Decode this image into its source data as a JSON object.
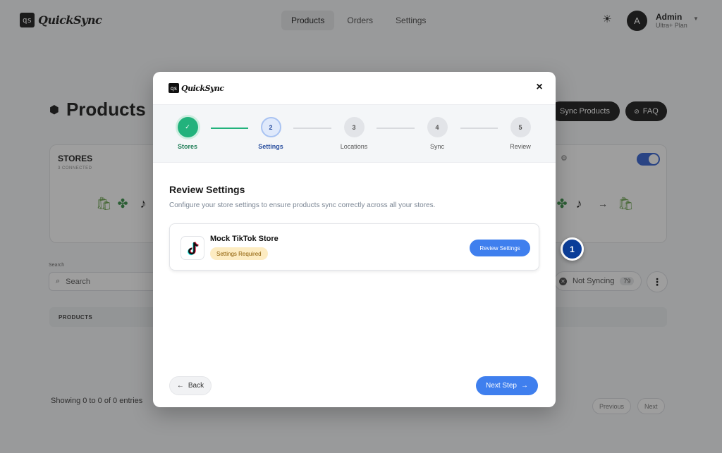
{
  "app": {
    "logo_mark": "qs",
    "logo_text": "QuickSync"
  },
  "nav": {
    "items": [
      "Products",
      "Orders",
      "Settings"
    ],
    "active": "Products"
  },
  "user": {
    "initial": "A",
    "name": "Admin",
    "plan": "Ultra+ Plan"
  },
  "page": {
    "title": "Products",
    "sync_button": "Sync Products",
    "faq_button": "FAQ",
    "stores_card": {
      "title": "STORES",
      "subtitle": "3 CONNECTED",
      "toggle_on": true
    },
    "search": {
      "label": "Search",
      "placeholder": "Search"
    },
    "filter": {
      "label": "Not Syncing",
      "count": "79"
    },
    "table_header": "PRODUCTS",
    "entries_text": "Showing 0 to 0 of 0 entries",
    "pager": {
      "previous": "Previous",
      "next": "Next"
    }
  },
  "tour": {
    "step_number": "1"
  },
  "modal": {
    "close_label": "×",
    "steps": [
      {
        "number": "✓",
        "label": "Stores",
        "state": "done"
      },
      {
        "number": "2",
        "label": "Settings",
        "state": "current"
      },
      {
        "number": "3",
        "label": "Locations",
        "state": "todo"
      },
      {
        "number": "4",
        "label": "Sync",
        "state": "todo"
      },
      {
        "number": "5",
        "label": "Review",
        "state": "todo"
      }
    ],
    "section_title": "Review Settings",
    "section_description": "Configure your store settings to ensure products sync correctly across all your stores.",
    "store": {
      "name": "Mock TikTok Store",
      "badge": "Settings Required",
      "action": "Review Settings"
    },
    "back_label": "Back",
    "next_label": "Next Step"
  },
  "colors": {
    "accent": "#3f7fee",
    "success": "#22b27c",
    "warning_bg": "#fdecc2",
    "dark": "#111111"
  }
}
